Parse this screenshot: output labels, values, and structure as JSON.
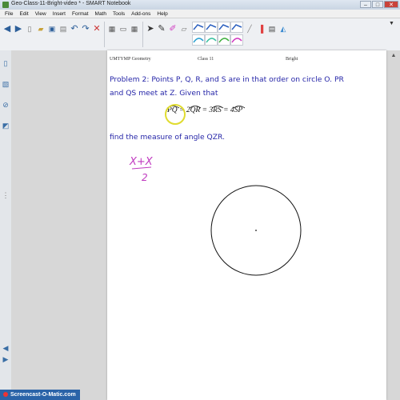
{
  "window": {
    "title": "Geo-Class-11-Bright-video * - SMART Notebook",
    "min": "–",
    "max": "□",
    "close": "✕"
  },
  "menu": [
    "File",
    "Edit",
    "View",
    "Insert",
    "Format",
    "Math",
    "Tools",
    "Add-ons",
    "Help"
  ],
  "page": {
    "header_left": "UMTYMP Geometry",
    "header_center": "Class 11",
    "header_right": "Bright",
    "problem_line1": "Problem 2:  Points P, Q, R, and S are in that order on circle O.  PR",
    "problem_line2": "and QS meet at Z.  Given that",
    "find": "find the measure of angle QZR.",
    "equation": "PQ = 2QR = 3RS = 4SP"
  },
  "handwriting": {
    "numerator": "X+X",
    "denominator": "2"
  },
  "watermark": "Screencast-O-Matic.com",
  "colors": {
    "problem_text": "#2626a8",
    "handwriting": "#c03ac0",
    "highlight": "#e0dc30"
  },
  "icons": [
    "prev-page-icon",
    "next-page-icon",
    "blank-page-icon",
    "open-icon",
    "save-icon",
    "paste-icon",
    "undo-icon",
    "redo-icon",
    "delete-icon",
    "screen-shade-icon",
    "display-icon",
    "table-icon",
    "select-arrow-icon",
    "pen-icon",
    "creative-pen-icon",
    "eraser-icon",
    "line-icon",
    "shapes-icon",
    "text-icon",
    "fill-icon",
    "properties-icon"
  ]
}
